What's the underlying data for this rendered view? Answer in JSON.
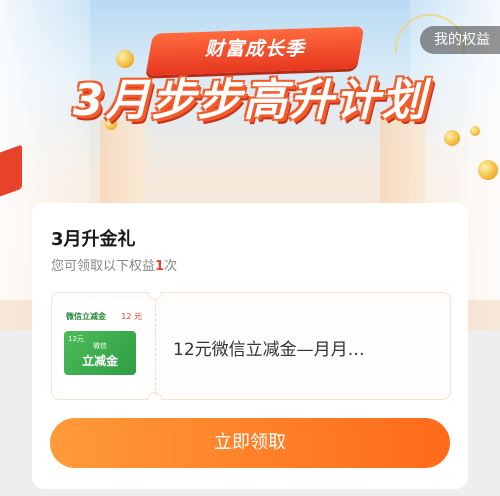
{
  "header": {
    "subtitle": "财富成长季",
    "title": "3月步步高升计划",
    "my_benefits": "我的权益"
  },
  "card": {
    "title": "3月升金礼",
    "sub_prefix": "您可领取以下权益",
    "sub_count": "1",
    "sub_suffix": "次",
    "coupon": {
      "thumb_head": "微信立减金",
      "thumb_amount": "12 元",
      "card_amount": "12元",
      "card_line1": "微信",
      "card_line2": "立减金",
      "name": "12元微信立减金—月月…"
    },
    "button": "立即领取"
  },
  "colors": {
    "accent": "#ff6a1a",
    "highlight": "#e8432a",
    "coupon_green": "#2f9e43"
  }
}
